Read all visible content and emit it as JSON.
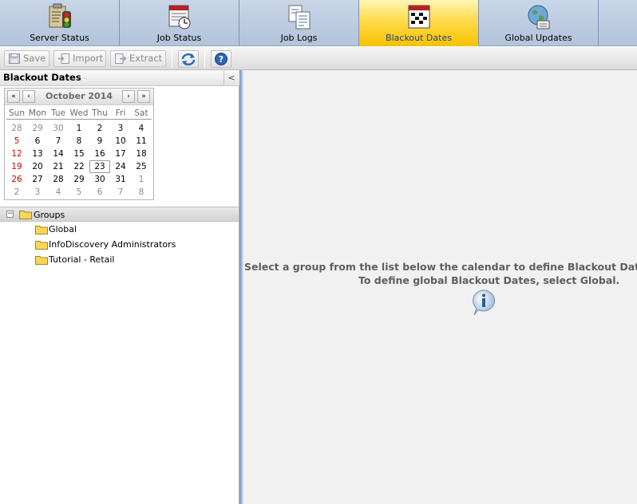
{
  "tabs": [
    {
      "label": "Server Status",
      "icon": "server-status-icon"
    },
    {
      "label": "Job Status",
      "icon": "job-status-icon"
    },
    {
      "label": "Job Logs",
      "icon": "job-logs-icon"
    },
    {
      "label": "Blackout Dates",
      "icon": "blackout-dates-icon",
      "active": true
    },
    {
      "label": "Global Updates",
      "icon": "global-updates-icon"
    }
  ],
  "toolbar": {
    "save_label": "Save",
    "import_label": "Import",
    "extract_label": "Extract",
    "refresh_icon": "refresh-icon",
    "help_icon": "help-icon"
  },
  "left_panel": {
    "title": "Blackout Dates",
    "collapse_glyph": "<"
  },
  "calendar": {
    "month_label": "October 2014",
    "nav": {
      "first": "«",
      "prev": "‹",
      "next": "›",
      "last": "»"
    },
    "weekdays": [
      "Sun",
      "Mon",
      "Tue",
      "Wed",
      "Thu",
      "Fri",
      "Sat"
    ],
    "weeks": [
      [
        "28",
        "29",
        "30",
        "1",
        "2",
        "3",
        "4"
      ],
      [
        "5",
        "6",
        "7",
        "8",
        "9",
        "10",
        "11"
      ],
      [
        "12",
        "13",
        "14",
        "15",
        "16",
        "17",
        "18"
      ],
      [
        "19",
        "20",
        "21",
        "22",
        "23",
        "24",
        "25"
      ],
      [
        "26",
        "27",
        "28",
        "29",
        "30",
        "31",
        "1"
      ],
      [
        "2",
        "3",
        "4",
        "5",
        "6",
        "7",
        "8"
      ]
    ],
    "today": "23"
  },
  "tree": {
    "root_label": "Groups",
    "root_toggle": "−",
    "children": [
      "Global",
      "InfoDiscovery Administrators",
      "Tutorial - Retail"
    ]
  },
  "main": {
    "message_line1": "Select a group from the list below the calendar to define Blackout Dates",
    "message_line2": "To define global Blackout Dates, select Global."
  },
  "colors": {
    "active_tab": "#ffd633",
    "tab_bar": "#b8c7de",
    "weekend_sunday": "#d40000"
  }
}
